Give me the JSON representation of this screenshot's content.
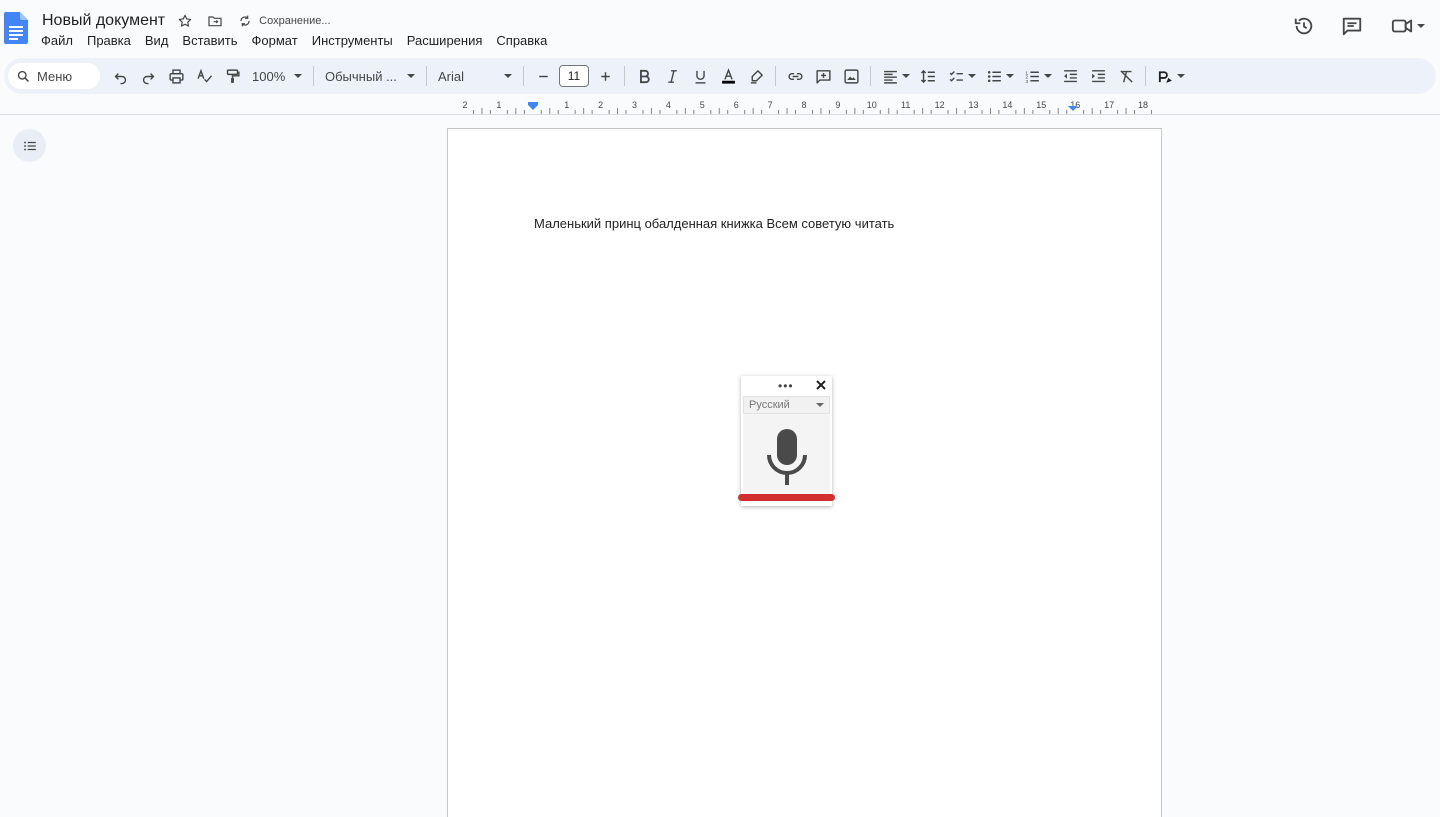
{
  "header": {
    "title": "Новый документ",
    "saving_status": "Сохранение...",
    "menu": [
      "Файл",
      "Правка",
      "Вид",
      "Вставить",
      "Формат",
      "Инструменты",
      "Расширения",
      "Справка"
    ]
  },
  "toolbar": {
    "menu_search": "Меню",
    "zoom": "100%",
    "paragraph_style": "Обычный ...",
    "font": "Arial",
    "font_size": "11"
  },
  "ruler": {
    "labels": [
      "2",
      "1",
      "",
      "1",
      "2",
      "3",
      "4",
      "5",
      "6",
      "7",
      "8",
      "9",
      "10",
      "11",
      "12",
      "13",
      "14",
      "15",
      "16",
      "17",
      "18"
    ]
  },
  "document": {
    "body_text": "Маленький принц обалденная книжка Всем советую читать"
  },
  "voice_typing": {
    "language": "Русский",
    "accent_color": "#d32f2f"
  },
  "colors": {
    "toolbar_bg": "#edf2fa",
    "page_bg": "#ffffff",
    "app_bg": "#f9fbfd",
    "docs_blue": "#4285f4"
  }
}
